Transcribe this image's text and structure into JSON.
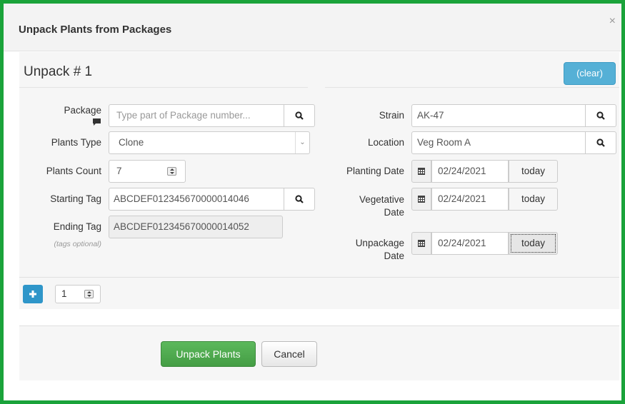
{
  "dialog": {
    "title": "Unpack Plants from Packages",
    "close_icon": "×"
  },
  "section": {
    "title": "Unpack # 1",
    "clear_label": "(clear)"
  },
  "left": {
    "package_label": "Package",
    "package_placeholder": "Type part of Package number...",
    "plants_type_label": "Plants Type",
    "plants_type_value": "Clone",
    "plants_count_label": "Plants Count",
    "plants_count_value": "7",
    "starting_tag_label": "Starting Tag",
    "starting_tag_value": "ABCDEF012345670000014046",
    "ending_tag_label": "Ending Tag",
    "ending_tag_value": "ABCDEF012345670000014052",
    "tags_optional": "(tags optional)"
  },
  "right": {
    "strain_label": "Strain",
    "strain_value": "AK-47",
    "location_label": "Location",
    "location_value": "Veg Room A",
    "planting_date_label": "Planting Date",
    "planting_date_value": "02/24/2021",
    "vegetative_label_1": "Vegetative",
    "vegetative_label_2": "Date",
    "vegetative_date_value": "02/24/2021",
    "unpackage_label_1": "Unpackage",
    "unpackage_label_2": "Date",
    "unpackage_date_value": "02/24/2021",
    "today_label": "today"
  },
  "add_row": {
    "count_value": "1"
  },
  "footer": {
    "submit_label": "Unpack Plants",
    "cancel_label": "Cancel"
  },
  "colors": {
    "frame_border": "#1aa33a",
    "primary_button": "#5cb85c",
    "info_button": "#55b0d6",
    "add_button": "#2f96c9"
  }
}
